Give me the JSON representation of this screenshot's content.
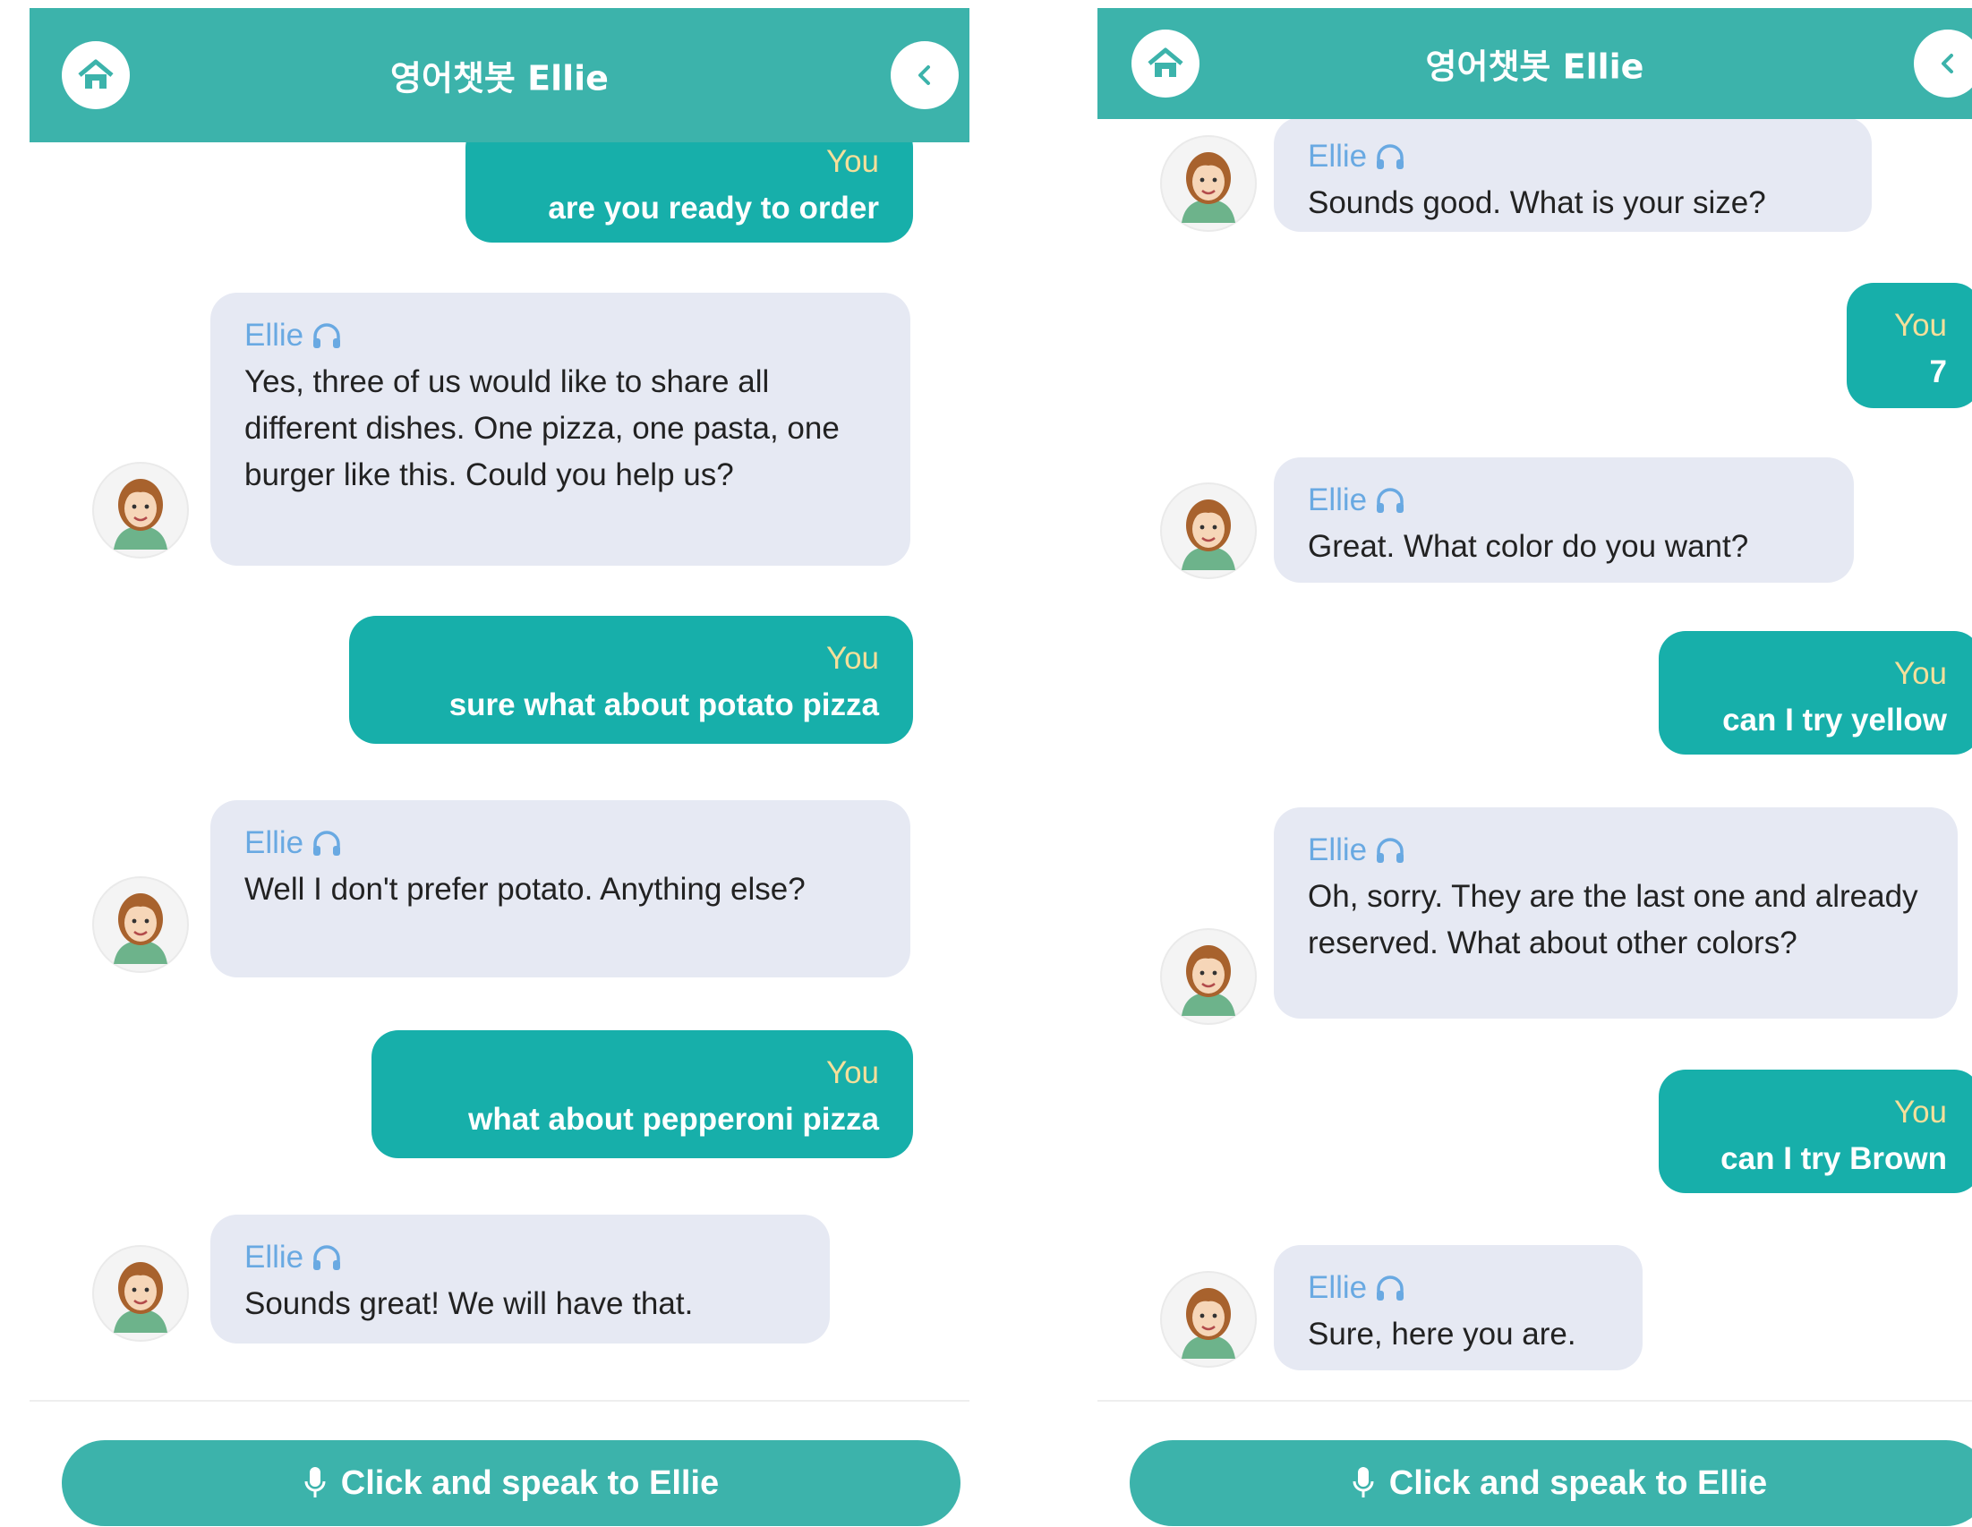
{
  "panels": [
    {
      "header": {
        "title": "영어챗봇 Ellie"
      },
      "messages": [
        {
          "sender": "You",
          "text": "are you ready to order"
        },
        {
          "sender": "Ellie",
          "text": "Yes, three of us would like to share all different dishes. One pizza, one pasta, one burger like this. Could you help us?"
        },
        {
          "sender": "You",
          "text": "sure what about potato pizza"
        },
        {
          "sender": "Ellie",
          "text": "Well I don't prefer potato. Anything else?"
        },
        {
          "sender": "You",
          "text": "what about pepperoni pizza"
        },
        {
          "sender": "Ellie",
          "text": "Sounds great! We will have that."
        }
      ],
      "speak_button": "Click and speak to Ellie"
    },
    {
      "header": {
        "title": "영어챗봇 Ellie"
      },
      "messages": [
        {
          "sender": "Ellie",
          "text": "Sounds good. What is your size?"
        },
        {
          "sender": "You",
          "text": "7"
        },
        {
          "sender": "Ellie",
          "text": "Great. What color do you want?"
        },
        {
          "sender": "You",
          "text": "can I try yellow"
        },
        {
          "sender": "Ellie",
          "text": "Oh, sorry. They are the last one and already reserved. What about other colors?"
        },
        {
          "sender": "You",
          "text": "can I try Brown"
        },
        {
          "sender": "Ellie",
          "text": "Sure, here you are."
        }
      ],
      "speak_button": "Click and speak to Ellie"
    }
  ],
  "icons": {
    "home": "home-icon",
    "back": "chevron-left-icon",
    "audio": "headphones-icon",
    "mic": "microphone-icon"
  },
  "colors": {
    "header": "#3cb3ab",
    "user_bubble": "#17afaa",
    "user_sender": "#f4df9a",
    "bot_bubble": "#e6e9f3",
    "bot_sender": "#69a9e2"
  }
}
